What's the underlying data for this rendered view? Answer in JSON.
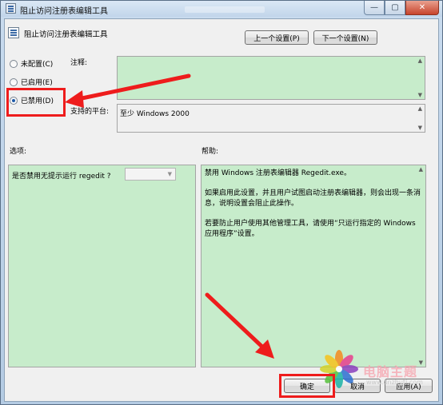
{
  "window": {
    "title": "阻止访问注册表编辑工具",
    "minimize_glyph": "—",
    "maximize_glyph": "▢",
    "close_glyph": "✕"
  },
  "header": {
    "policy_name": "阻止访问注册表编辑工具",
    "prev_button": "上一个设置(P)",
    "next_button": "下一个设置(N)"
  },
  "options": [
    {
      "label": "未配置(C)",
      "checked": false
    },
    {
      "label": "已启用(E)",
      "checked": false
    },
    {
      "label": "已禁用(D)",
      "checked": true
    }
  ],
  "comment": {
    "label": "注释:",
    "value": ""
  },
  "platform": {
    "label": "支持的平台:",
    "value": "至少 Windows 2000"
  },
  "options_panel": {
    "label": "选项:",
    "question": "是否禁用无提示运行 regedit ?",
    "dropdown_value": ""
  },
  "help_panel": {
    "label": "帮助:",
    "paragraphs": [
      "禁用 Windows 注册表编辑器 Regedit.exe。",
      "如果启用此设置，并且用户试图启动注册表编辑器，则会出现一条消息，说明设置会阻止此操作。",
      "若要防止用户使用其他管理工具，请使用“只运行指定的 Windows 应用程序”设置。"
    ]
  },
  "footer": {
    "ok_button": "确定",
    "cancel_button": "取消",
    "apply_button": "应用(A)"
  },
  "watermark": {
    "text": "电脑主题",
    "url": "www.dnzhuti.com"
  },
  "colors": {
    "annotation_red": "#ee1c1c",
    "panel_green": "#c7eccb",
    "radio_accent": "#1e5aa8"
  }
}
